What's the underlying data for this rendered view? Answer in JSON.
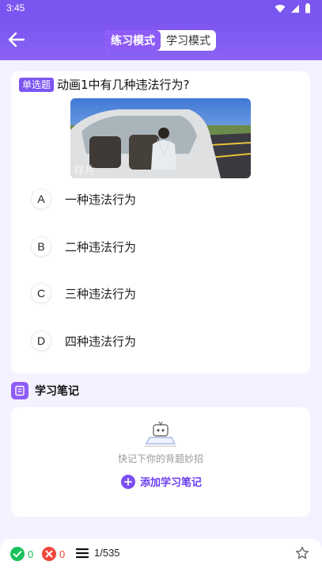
{
  "status": {
    "time": "3:45"
  },
  "header": {
    "tabs": [
      {
        "label": "练习模式",
        "active": true
      },
      {
        "label": "学习模式",
        "active": false
      }
    ]
  },
  "question": {
    "type_badge": "单选题",
    "text": "动画1中有几种违法行为?",
    "image_watermark": "样片",
    "options": [
      {
        "letter": "A",
        "text": "一种违法行为"
      },
      {
        "letter": "B",
        "text": "二种违法行为"
      },
      {
        "letter": "C",
        "text": "三种违法行为"
      },
      {
        "letter": "D",
        "text": "四种违法行为"
      }
    ]
  },
  "notes": {
    "title": "学习笔记",
    "hint": "快记下你的背题妙招",
    "add_label": "添加学习笔记"
  },
  "bottom": {
    "correct_count": "0",
    "wrong_count": "0",
    "progress": "1/535"
  },
  "colors": {
    "accent": "#7b55f0",
    "correct": "#19c15b",
    "wrong": "#f0453a",
    "card_bg": "#ffffff",
    "page_bg": "#f5f2ff"
  }
}
